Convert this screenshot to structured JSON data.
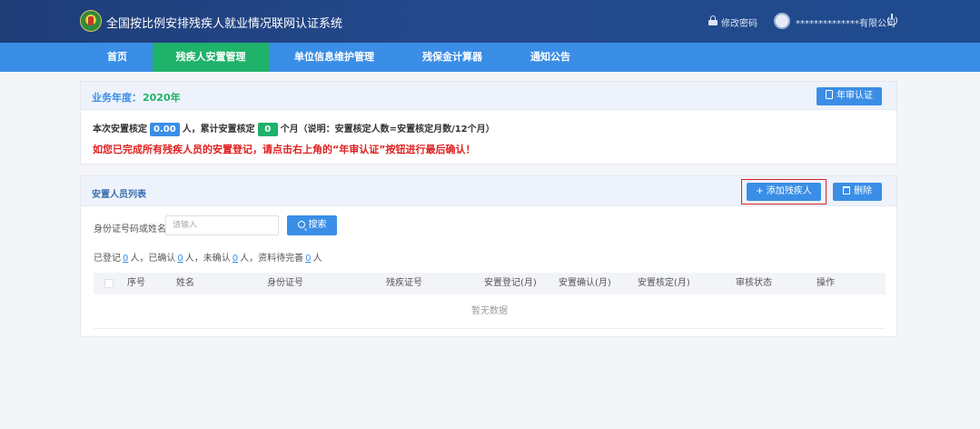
{
  "header": {
    "title": "全国按比例安排残疾人就业情况联网认证系统",
    "change_password": "修改密码",
    "company_name": "**************有限公司"
  },
  "nav": {
    "items": [
      {
        "label": "首页"
      },
      {
        "label": "残疾人安置管理",
        "active": true
      },
      {
        "label": "单位信息维护管理"
      },
      {
        "label": "残保金计算器"
      },
      {
        "label": "通知公告"
      }
    ]
  },
  "business": {
    "year_label": "业务年度：",
    "year_value": "2020年",
    "annual_cert_button": "年审认证",
    "line_prefix": "本次安置核定",
    "current_value": "0.00",
    "line_mid": "人，累计安置核定",
    "cumulative_value": "0",
    "line_suffix": "个月（说明：安置核定人数=安置核定月数/12个月）",
    "warning": "如您已完成所有残疾人员的安置登记，请点击右上角的“年审认证”按钮进行最后确认！"
  },
  "staff_list": {
    "title": "安置人员列表",
    "add_button": "+ 添加残疾人",
    "delete_button": "删除",
    "search_label": "身份证号码或姓名",
    "search_placeholder": "请输入",
    "search_button": "搜索",
    "stats": {
      "registered_label": "已登记",
      "registered_value": "0",
      "confirmed_label": "人，已确认",
      "confirmed_value": "0",
      "unconfirmed_label": "人，未确认",
      "unconfirmed_value": "0",
      "pending_label": "人，资料待完善",
      "pending_value": "0",
      "tail": "人"
    },
    "columns": [
      "序号",
      "姓名",
      "身份证号",
      "残疾证号",
      "安置登记(月)",
      "安置确认(月)",
      "安置核定(月)",
      "审核状态",
      "操作"
    ],
    "empty_text": "暂无数据"
  },
  "colors": {
    "header_bg": "#1e3d78",
    "nav_bg": "#3a8ee6",
    "nav_active": "#1fb26a",
    "warning": "#e02020",
    "year": "#1fb26a"
  }
}
